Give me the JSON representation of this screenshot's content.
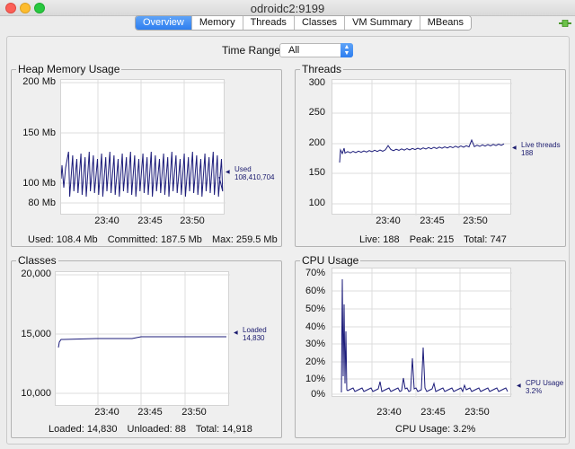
{
  "window": {
    "title": "odroidc2:9199"
  },
  "tabs": [
    "Overview",
    "Memory",
    "Threads",
    "Classes",
    "VM Summary",
    "MBeans"
  ],
  "time_range": {
    "label": "Time Range:",
    "value": "All"
  },
  "colors": {
    "series": "#1c1c7a",
    "grid": "#dcdcdc",
    "tab_active": "#2d7ef0"
  },
  "x_ticks": [
    "23:40",
    "23:45",
    "23:50"
  ],
  "heap": {
    "title": "Heap Memory Usage",
    "y_ticks": [
      "200 Mb",
      "150 Mb",
      "100 Mb",
      "80 Mb"
    ],
    "legend_name": "Used",
    "legend_value": "108,410,704",
    "stats": {
      "used": "Used: 108.4 Mb",
      "committed": "Committed: 187.5 Mb",
      "max": "Max: 259.5 Mb"
    }
  },
  "threads": {
    "title": "Threads",
    "y_ticks": [
      "300",
      "250",
      "200",
      "150",
      "100"
    ],
    "legend_name": "Live threads",
    "legend_value": "188",
    "stats": {
      "live": "Live: 188",
      "peak": "Peak: 215",
      "total": "Total: 747"
    }
  },
  "classes": {
    "title": "Classes",
    "y_ticks": [
      "20,000",
      "15,000",
      "10,000"
    ],
    "legend_name": "Loaded",
    "legend_value": "14,830",
    "stats": {
      "loaded": "Loaded: 14,830",
      "unloaded": "Unloaded: 88",
      "total": "Total: 14,918"
    }
  },
  "cpu": {
    "title": "CPU Usage",
    "y_ticks": [
      "70%",
      "60%",
      "50%",
      "40%",
      "30%",
      "20%",
      "10%",
      "0%"
    ],
    "legend_name": "CPU Usage",
    "legend_value": "3.2%",
    "stats": {
      "usage": "CPU Usage: 3.2%"
    }
  }
}
